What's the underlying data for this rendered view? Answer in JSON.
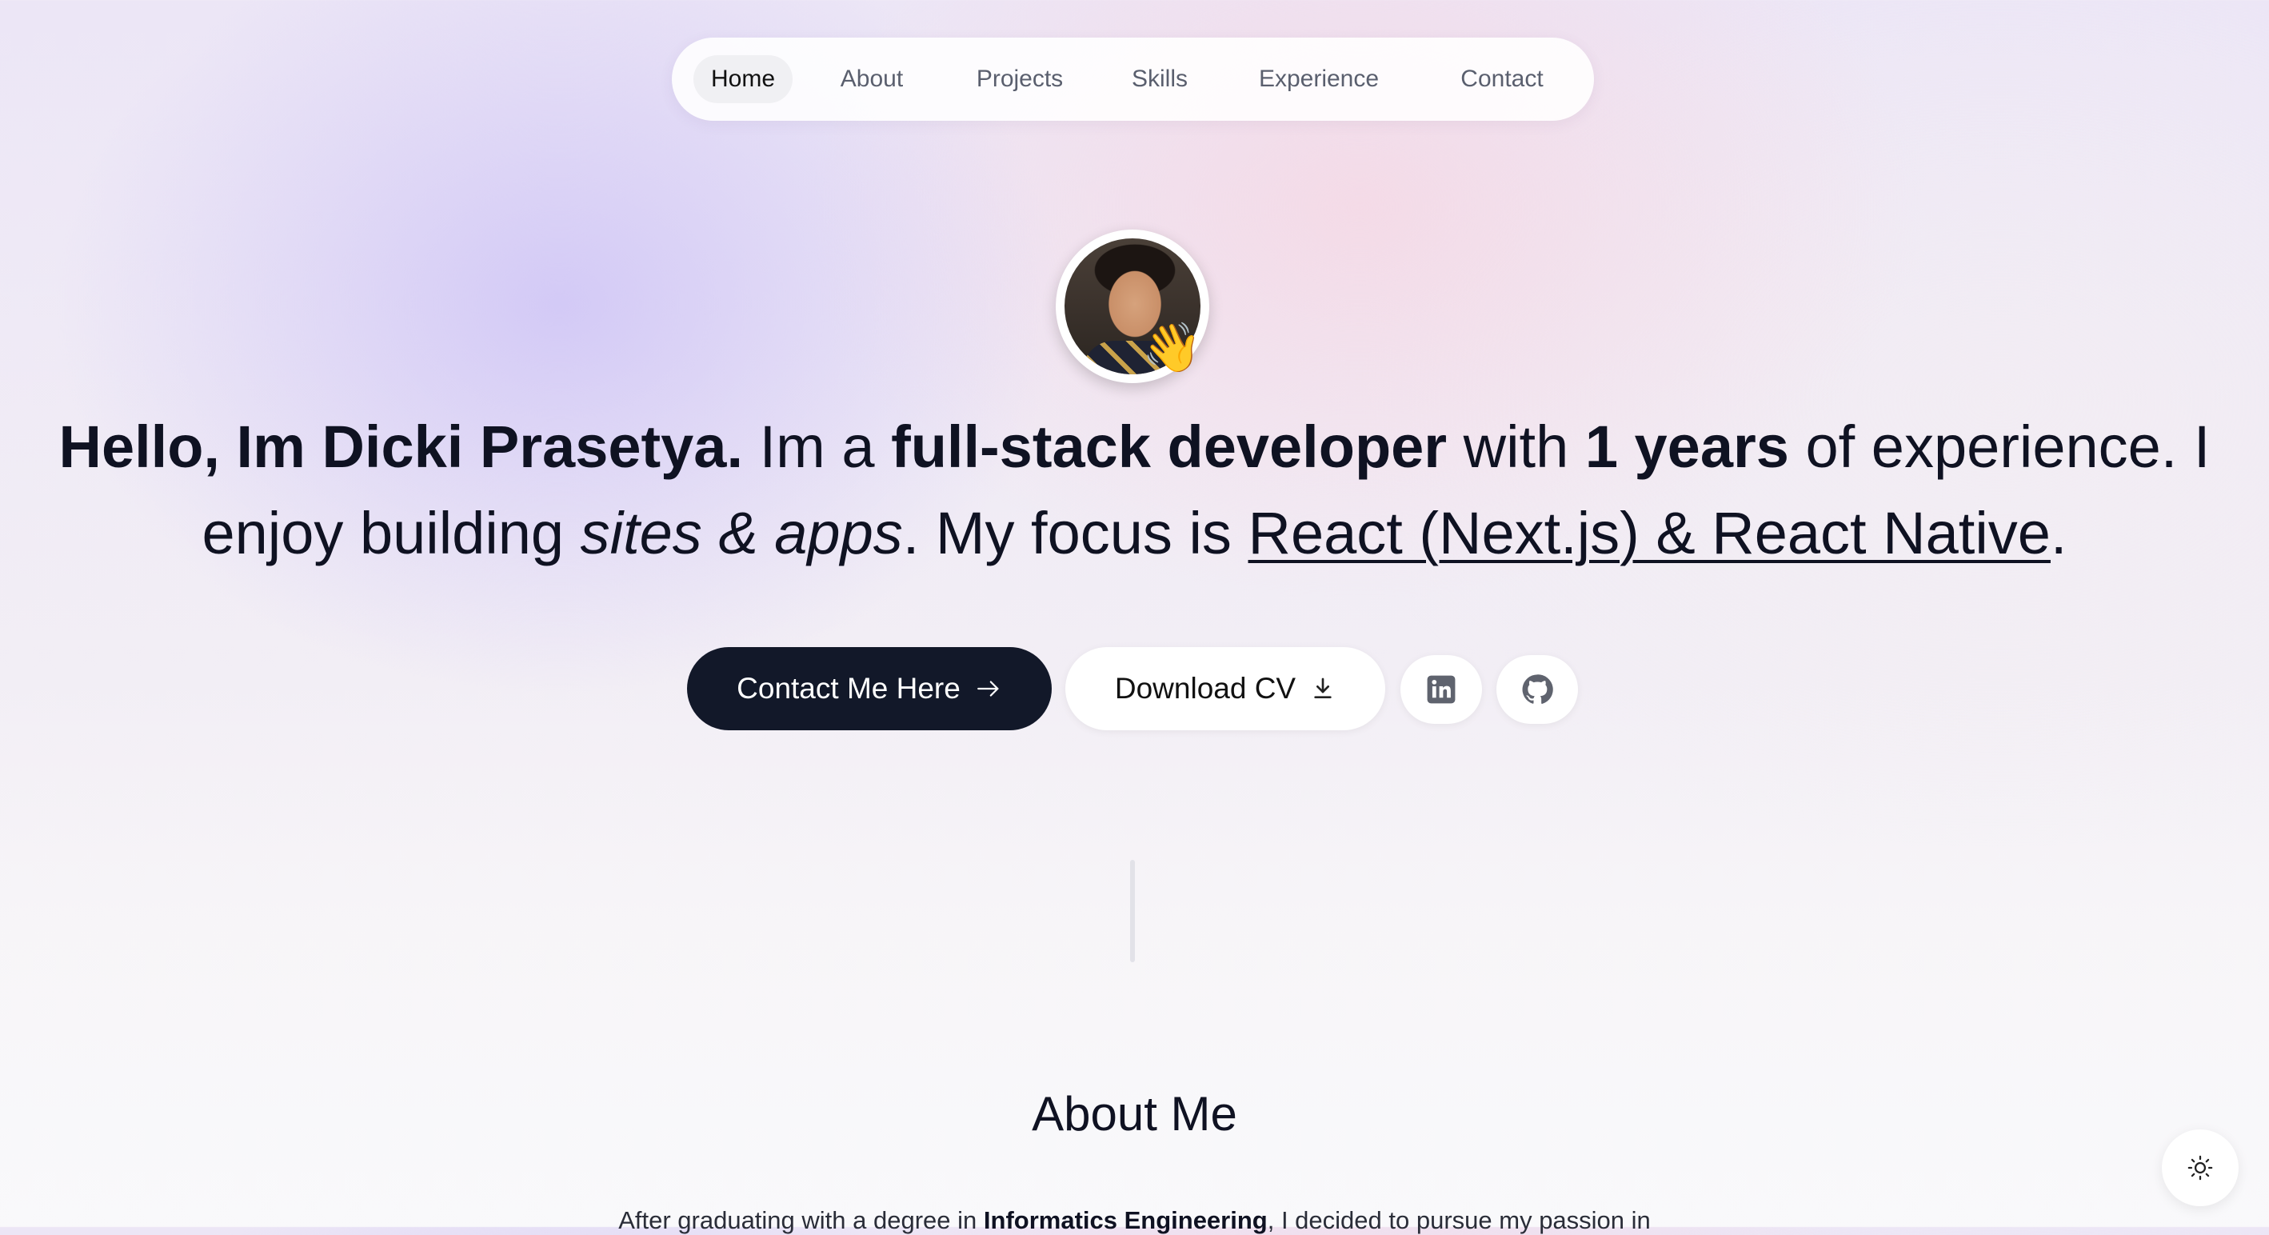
{
  "nav": {
    "items": [
      {
        "label": "Home",
        "active": true
      },
      {
        "label": "About"
      },
      {
        "label": "Projects"
      },
      {
        "label": "Skills"
      },
      {
        "label": "Experience"
      },
      {
        "label": "Contact"
      }
    ]
  },
  "hero": {
    "avatar_icon": "avatar",
    "wave_emoji": "👋",
    "headline": {
      "hello": "Hello, Im Dicki Prasetya.",
      "im_a": " Im a ",
      "role": "full-stack developer",
      "with": " with ",
      "years": "1 years",
      "experience": " of experience. I enjoy building ",
      "sites_apps": "sites & apps",
      "focus": ". My focus is ",
      "tech": "React (Next.js) & React Native",
      "end": "."
    },
    "contact_button": "Contact Me Here",
    "download_button": "Download CV",
    "icons": {
      "contact": "arrow-right-icon",
      "download": "download-icon",
      "linkedin": "linkedin-icon",
      "github": "github-icon"
    }
  },
  "about": {
    "title": "About Me",
    "text_before": "After graduating with a degree in ",
    "text_bold": "Informatics Engineering",
    "text_after": ", I decided to pursue my passion in"
  },
  "theme_toggle": {
    "icon": "sun-icon"
  },
  "colors": {
    "dark_button": "#121829",
    "text": "#0f1222"
  }
}
